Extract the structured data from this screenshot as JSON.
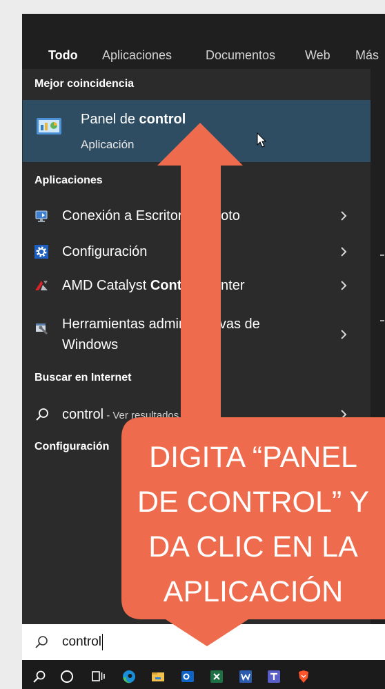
{
  "tabs": [
    {
      "label": "Todo",
      "active": true
    },
    {
      "label": "Aplicaciones"
    },
    {
      "label": "Documentos"
    },
    {
      "label": "Web"
    },
    {
      "label": "Más"
    }
  ],
  "best_match": {
    "header": "Mejor coincidencia",
    "title_prefix": "Panel de ",
    "title_match": "control",
    "subtitle": "Aplicación",
    "icon": "control-panel-icon"
  },
  "apps": {
    "header": "Aplicaciones",
    "items": [
      {
        "label": "Conexión a Escritorio remoto",
        "icon": "remote-desktop-icon"
      },
      {
        "label": "Configuración",
        "icon": "settings-gear-icon"
      },
      {
        "label": "AMD Catalyst ",
        "match": "Control",
        "label_end": " Center",
        "icon": "amd-catalyst-icon"
      },
      {
        "label": "Herramientas administrativas de",
        "label_line2": "Windows",
        "icon": "administrative-tools-icon"
      }
    ]
  },
  "web": {
    "header": "Buscar en Internet",
    "query": "control",
    "hint": " - Ver resultados web",
    "icon": "search-icon"
  },
  "settings_section": {
    "header": "Configuración"
  },
  "search_box": {
    "value": "control",
    "icon": "search-icon"
  },
  "taskbar": {
    "icons": [
      "search-icon",
      "cortana-icon",
      "task-view-icon",
      "edge-icon",
      "file-explorer-icon",
      "outlook-icon",
      "excel-icon",
      "word-icon",
      "teams-icon",
      "brave-icon"
    ]
  },
  "callout": {
    "lines": [
      "DIGITA “PANEL",
      "DE CONTROL” Y",
      "DA CLIC EN LA",
      "APLICACIÓN"
    ],
    "color": "#EE6C4D"
  },
  "colors": {
    "header_bar": "#1f1f1f",
    "list": "#2b2b2b",
    "selected": "#2e4c62",
    "search_box": "#ffffff",
    "taskbar": "#1b1b1b",
    "callout": "#EE6C4D"
  }
}
